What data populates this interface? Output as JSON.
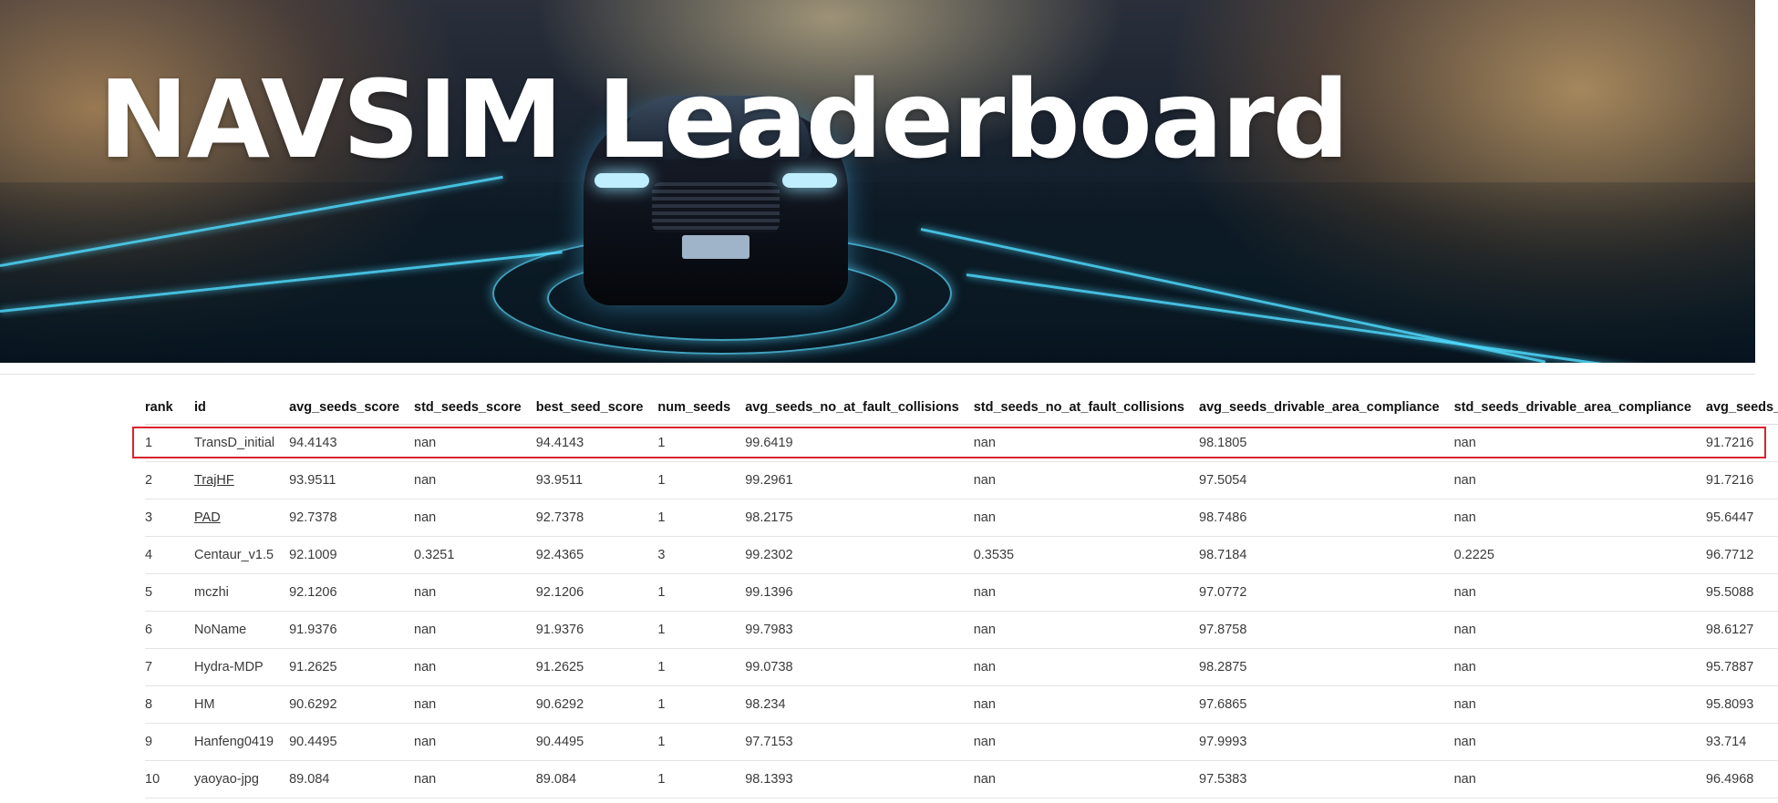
{
  "banner": {
    "title": "NAVSIM Leaderboard"
  },
  "colors": {
    "highlight": "#d9232e",
    "header_text": "#111111",
    "body_text": "#3a3a3a"
  },
  "table": {
    "columns": [
      "rank",
      "id",
      "avg_seeds_score",
      "std_seeds_score",
      "best_seed_score",
      "num_seeds",
      "avg_seeds_no_at_fault_collisions",
      "std_seeds_no_at_fault_collisions",
      "avg_seeds_drivable_area_compliance",
      "std_seeds_drivable_area_compliance",
      "avg_seeds_driving"
    ],
    "rows": [
      {
        "rank": "1",
        "id": "TransD_initial",
        "id_link": false,
        "highlighted": true,
        "cells": [
          "94.4143",
          "nan",
          "94.4143",
          "1",
          "99.6419",
          "nan",
          "98.1805",
          "nan",
          "91.7216"
        ]
      },
      {
        "rank": "2",
        "id": "TrajHF",
        "id_link": true,
        "highlighted": false,
        "cells": [
          "93.9511",
          "nan",
          "93.9511",
          "1",
          "99.2961",
          "nan",
          "97.5054",
          "nan",
          "91.7216"
        ]
      },
      {
        "rank": "3",
        "id": "PAD",
        "id_link": true,
        "highlighted": false,
        "cells": [
          "92.7378",
          "nan",
          "92.7378",
          "1",
          "98.2175",
          "nan",
          "98.7486",
          "nan",
          "95.6447"
        ]
      },
      {
        "rank": "4",
        "id": "Centaur_v1.5",
        "id_link": false,
        "highlighted": false,
        "cells": [
          "92.1009",
          "0.3251",
          "92.4365",
          "3",
          "99.2302",
          "0.3535",
          "98.7184",
          "0.2225",
          "96.7712"
        ]
      },
      {
        "rank": "5",
        "id": "mczhi",
        "id_link": false,
        "highlighted": false,
        "cells": [
          "92.1206",
          "nan",
          "92.1206",
          "1",
          "99.1396",
          "nan",
          "97.0772",
          "nan",
          "95.5088"
        ]
      },
      {
        "rank": "6",
        "id": "NoName",
        "id_link": false,
        "highlighted": false,
        "cells": [
          "91.9376",
          "nan",
          "91.9376",
          "1",
          "99.7983",
          "nan",
          "97.8758",
          "nan",
          "98.6127"
        ]
      },
      {
        "rank": "7",
        "id": "Hydra-MDP",
        "id_link": false,
        "highlighted": false,
        "cells": [
          "91.2625",
          "nan",
          "91.2625",
          "1",
          "99.0738",
          "nan",
          "98.2875",
          "nan",
          "95.7887"
        ]
      },
      {
        "rank": "8",
        "id": "HM",
        "id_link": false,
        "highlighted": false,
        "cells": [
          "90.6292",
          "nan",
          "90.6292",
          "1",
          "98.234",
          "nan",
          "97.6865",
          "nan",
          "95.8093"
        ]
      },
      {
        "rank": "9",
        "id": "Hanfeng0419",
        "id_link": false,
        "highlighted": false,
        "cells": [
          "90.4495",
          "nan",
          "90.4495",
          "1",
          "97.7153",
          "nan",
          "97.9993",
          "nan",
          "93.714"
        ]
      },
      {
        "rank": "10",
        "id": "yaoyao-jpg",
        "id_link": false,
        "highlighted": false,
        "cells": [
          "89.084",
          "nan",
          "89.084",
          "1",
          "98.1393",
          "nan",
          "97.5383",
          "nan",
          "96.4968"
        ]
      }
    ]
  }
}
